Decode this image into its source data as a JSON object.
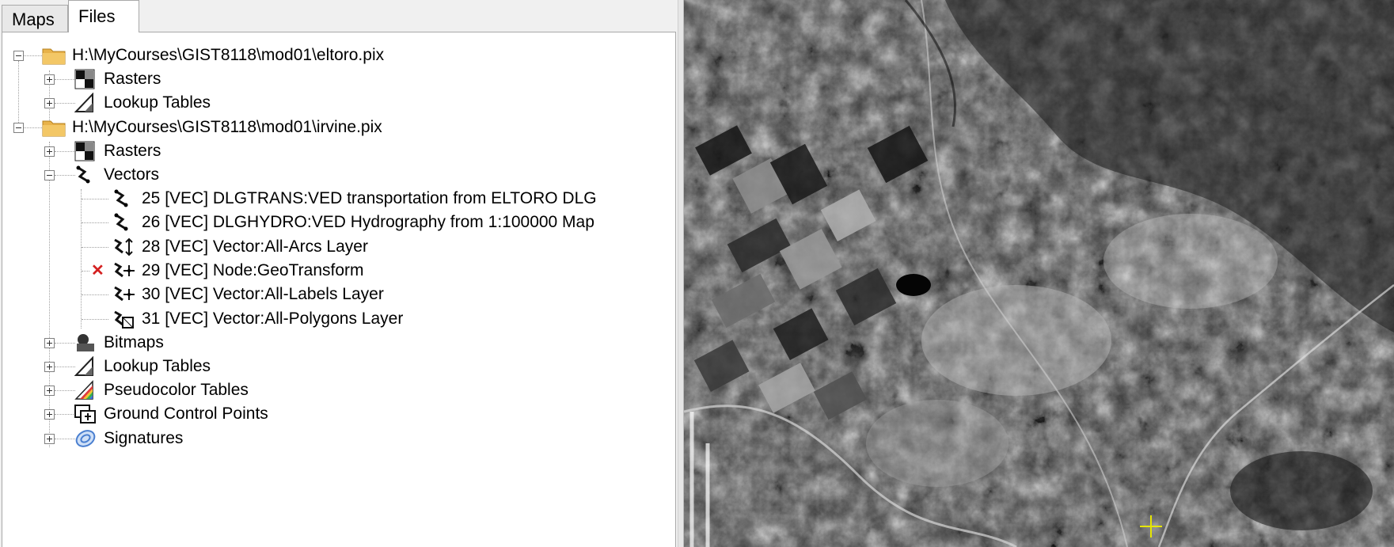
{
  "tabs": {
    "maps": "Maps",
    "files": "Files"
  },
  "tree": {
    "file1": {
      "path": "H:\\MyCourses\\GIST8118\\mod01\\eltoro.pix",
      "rasters": "Rasters",
      "lookup": "Lookup Tables"
    },
    "file2": {
      "path": "H:\\MyCourses\\GIST8118\\mod01\\irvine.pix",
      "rasters": "Rasters",
      "vectors": "Vectors",
      "vector_items": [
        "25 [VEC] DLGTRANS:VED transportation from ELTORO DLG",
        "26 [VEC] DLGHYDRO:VED Hydrography from 1:100000 Map",
        "28 [VEC] Vector:All-Arcs Layer",
        "29 [VEC] Node:GeoTransform",
        "30 [VEC] Vector:All-Labels Layer",
        "31 [VEC] Vector:All-Polygons Layer"
      ],
      "bitmaps": "Bitmaps",
      "lookup": "Lookup Tables",
      "pseudocolor": "Pseudocolor Tables",
      "gcp": "Ground Control Points",
      "signatures": "Signatures"
    }
  },
  "icons": {
    "folder": "folder-icon",
    "raster": "raster-icon",
    "lut": "lookup-table-icon",
    "vector": "vector-icon",
    "bitmap": "bitmap-icon",
    "pct": "pseudocolor-icon",
    "gcp": "gcp-icon",
    "sig": "signature-icon",
    "deleted": "red-x-icon"
  },
  "colors": {
    "folder": "#e8b24a",
    "deleted_mark": "#d42020"
  }
}
